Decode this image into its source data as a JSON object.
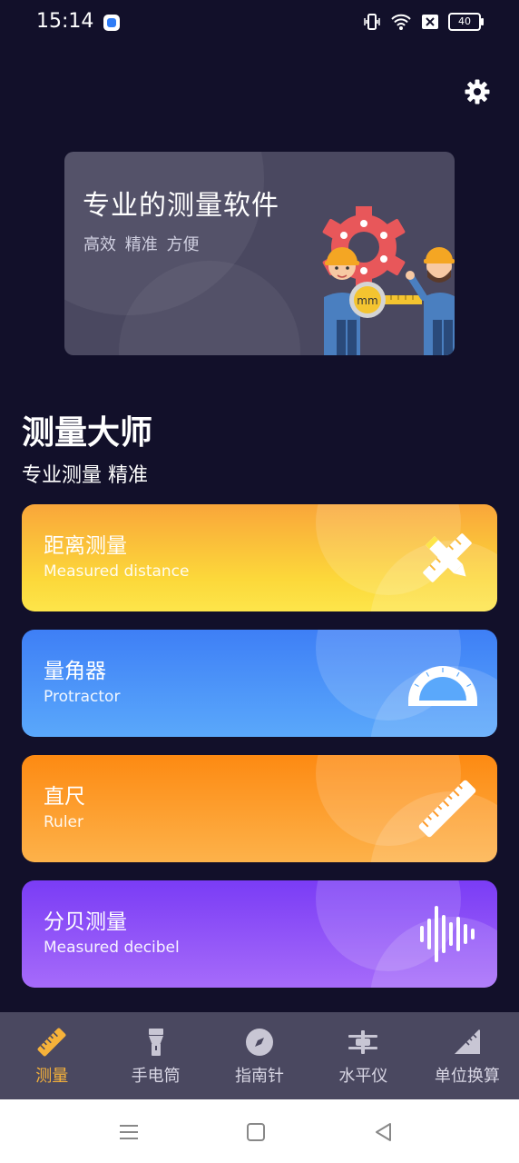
{
  "status_bar": {
    "time": "15:14",
    "battery": "40",
    "icons": [
      "app-icon",
      "vibrate-icon",
      "wifi-icon",
      "sim-off-icon",
      "battery-icon"
    ]
  },
  "header": {
    "settings_icon": "gear-icon"
  },
  "banner": {
    "title": "专业的测量软件",
    "subtitle": "高效  精准  方便",
    "tape_label": "mm"
  },
  "app": {
    "title": "测量大师",
    "subtitle": "专业测量 精准"
  },
  "cards": [
    {
      "title": "距离测量",
      "subtitle": "Measured distance",
      "icon": "ruler-pencil-icon",
      "gradient": [
        "#f9a63a",
        "#fde54a"
      ]
    },
    {
      "title": "量角器",
      "subtitle": "Protractor",
      "icon": "protractor-icon",
      "gradient": [
        "#3e7ff6",
        "#5aa8fb"
      ]
    },
    {
      "title": "直尺",
      "subtitle": "Ruler",
      "icon": "ruler-icon",
      "gradient": [
        "#fd8a12",
        "#fdb24a"
      ]
    },
    {
      "title": "分贝测量",
      "subtitle": "Measured decibel",
      "icon": "sound-wave-icon",
      "gradient": [
        "#7a3cf5",
        "#a66bfa"
      ]
    }
  ],
  "tabs": [
    {
      "label": "测量",
      "icon": "ruler-icon",
      "active": true
    },
    {
      "label": "手电筒",
      "icon": "flashlight-icon",
      "active": false
    },
    {
      "label": "指南针",
      "icon": "compass-icon",
      "active": false
    },
    {
      "label": "水平仪",
      "icon": "level-icon",
      "active": false
    },
    {
      "label": "单位换算",
      "icon": "unit-convert-icon",
      "active": false
    }
  ],
  "colors": {
    "background": "#12102a",
    "tabbar": "#4a4860",
    "active_tab": "#f6b23a",
    "inactive_tab": "#d8d6e4"
  },
  "system_nav": [
    "menu-icon",
    "home-icon",
    "back-icon"
  ]
}
